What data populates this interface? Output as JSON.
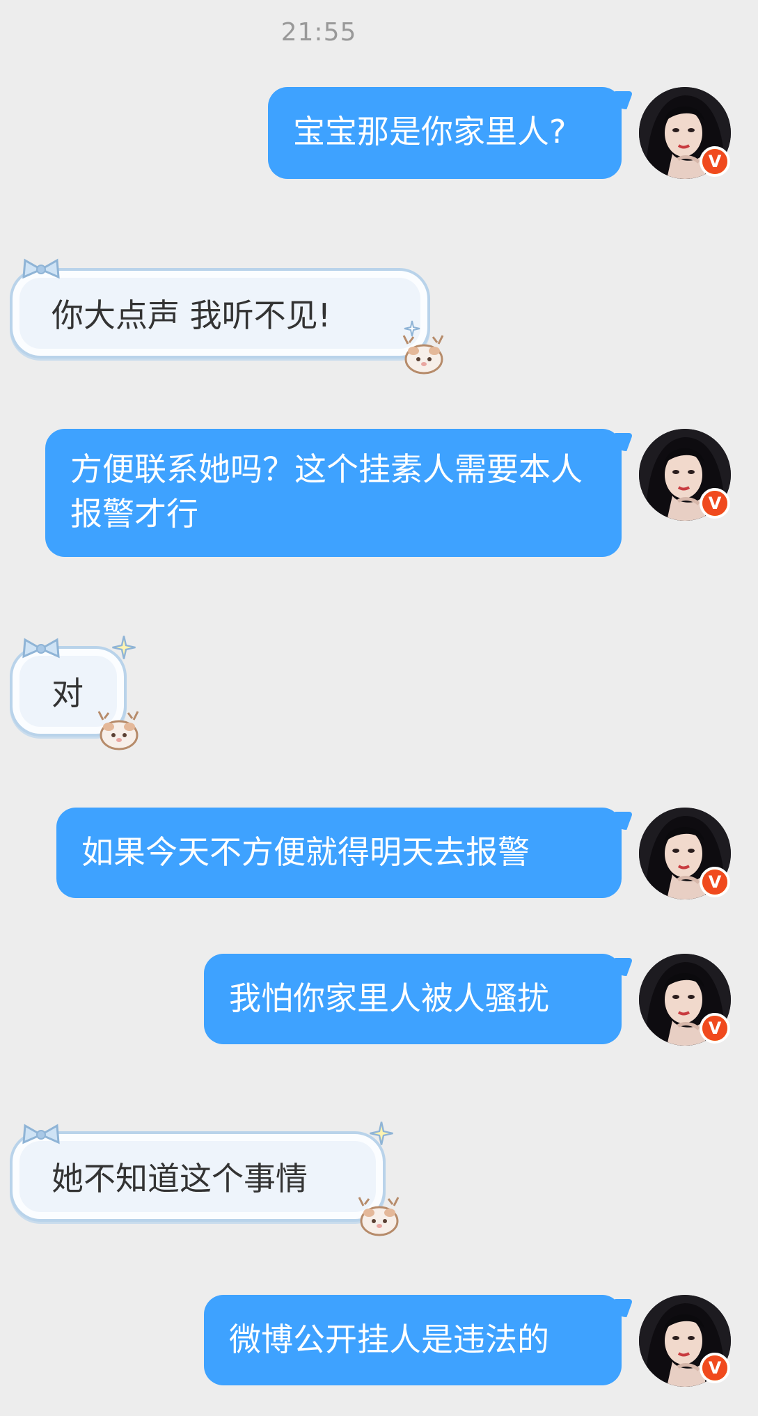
{
  "timestamp": "21:55",
  "messages": [
    {
      "type": "out",
      "text": "宝宝那是你家里人?"
    },
    {
      "type": "in",
      "text": "你大点声 我听不见!"
    },
    {
      "type": "out",
      "text": "方便联系她吗？这个挂素人需要本人报警才行"
    },
    {
      "type": "in",
      "text": "对"
    },
    {
      "type": "out",
      "text": "如果今天不方便就得明天去报警"
    },
    {
      "type": "out",
      "text": "我怕你家里人被人骚扰"
    },
    {
      "type": "in",
      "text": "她不知道这个事情"
    },
    {
      "type": "out",
      "text": "微博公开挂人是违法的"
    }
  ],
  "colors": {
    "background": "#ededed",
    "outgoing_bubble": "#3ea2ff",
    "incoming_bubble": "#eef4fb",
    "incoming_border": "#b9d3ea",
    "verified_badge": "#f04a1e"
  },
  "icons": {
    "verified_badge": "verified-v-badge",
    "bubble_bow": "bow-icon",
    "bubble_deer": "deer-icon",
    "bubble_sparkle": "sparkle-icon"
  }
}
